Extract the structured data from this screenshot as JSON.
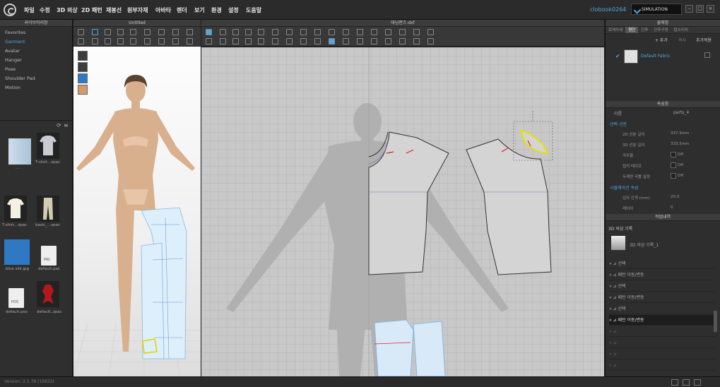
{
  "menu": [
    "파일",
    "수정",
    "3D 의상",
    "2D 패턴",
    "재봉선",
    "원부자재",
    "아바타",
    "렌더",
    "보기",
    "환경",
    "설정",
    "도움말"
  ],
  "user": "clobook0264",
  "simulation": "SIMULATION",
  "library": {
    "title": "라이브러리창",
    "favorites": "Favorites",
    "items": [
      "Garment",
      "Avatar",
      "Hanger",
      "Pose",
      "Shoulder Pad",
      "Motion"
    ],
    "thumbs": [
      "...",
      "T-shirt...zpac",
      "T-shirt...zpac",
      "basic_...zpac",
      "blue silk.jpg",
      "default.pac",
      "default.pos",
      "default..zpac"
    ]
  },
  "view3d_title": "Untitled",
  "view2d_title": "대님랜즈.dxf",
  "fabric": {
    "title": "물체창",
    "tabs": [
      "로케카세",
      "원단",
      "단추",
      "단추구멍",
      "탑스티치"
    ],
    "add": "+ 추가",
    "copy": "복사",
    "attach": "추가적용",
    "item": "Default Fabric"
  },
  "props": {
    "title": "속성창",
    "pattern_label": "이름",
    "pattern_value": "parts_4",
    "section1": "선택 선분",
    "rows": [
      [
        "2D 선분 길이",
        "337.9mm"
      ],
      [
        "3D 선분 길이",
        "333.5mm"
      ],
      [
        "곡무율",
        "Off"
      ],
      [
        "접지 테이프",
        "Off"
      ],
      [
        "두께면 곡률 설정",
        "Off"
      ]
    ],
    "section2": "시뮬레이션 속성",
    "rows2": [
      [
        "입자 간격 (mm)",
        "20.0"
      ],
      [
        "레이어",
        "0"
      ]
    ]
  },
  "history": {
    "title": "작업내역",
    "header": "3D 의상 기록",
    "record": "3D 의상 기록_1",
    "rows": [
      "선택",
      "패턴 이동/변동",
      "선택",
      "패턴 이동/변동",
      "선택",
      "패턴 이동/변동",
      "",
      "",
      "",
      ""
    ]
  },
  "status": "Version: 2.1.78     (16832)"
}
